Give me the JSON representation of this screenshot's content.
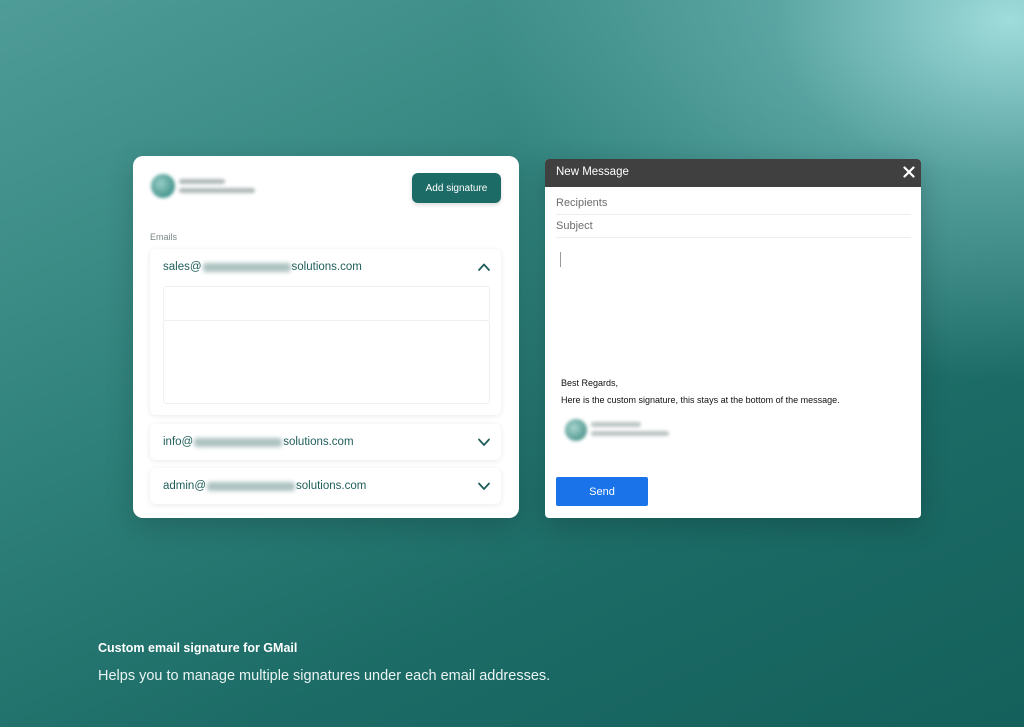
{
  "signature_panel": {
    "add_signature_label": "Add signature",
    "emails_label": "Emails",
    "emails": [
      {
        "prefix": "sales@",
        "suffix": "solutions.com",
        "expanded": true,
        "chevron": "chevron-up-icon"
      },
      {
        "prefix": "info@",
        "suffix": "solutions.com",
        "expanded": false,
        "chevron": "chevron-down-icon"
      },
      {
        "prefix": "admin@",
        "suffix": "solutions.com",
        "expanded": false,
        "chevron": "chevron-down-icon"
      }
    ]
  },
  "compose": {
    "title": "New Message",
    "close_icon": "close-icon",
    "recipients_placeholder": "Recipients",
    "subject_placeholder": "Subject",
    "signature_greeting": "Best Regards,",
    "signature_text": "Here is the custom signature, this stays at the bottom of the message.",
    "send_label": "Send"
  },
  "caption": {
    "title": "Custom email signature for GMail",
    "description": "Helps you to manage multiple signatures under each email addresses."
  },
  "colors": {
    "primary": "#1d6b66",
    "send_button": "#1a73e8",
    "compose_header": "#404040",
    "email_text": "#1f5e5a"
  }
}
